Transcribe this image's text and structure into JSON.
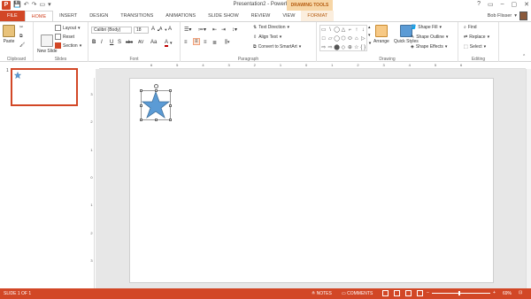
{
  "window": {
    "title": "Presentation2 - PowerPoint",
    "contextual_banner": "DRAWING TOOLS",
    "user": "Bob Flisser",
    "controls": [
      "?",
      "▭",
      "–",
      "▢",
      "✕"
    ]
  },
  "tabs": [
    "FILE",
    "HOME",
    "INSERT",
    "DESIGN",
    "TRANSITIONS",
    "ANIMATIONS",
    "SLIDE SHOW",
    "REVIEW",
    "VIEW",
    "FORMAT"
  ],
  "ribbon": {
    "clipboard": {
      "label": "Clipboard",
      "paste": "Paste"
    },
    "slides": {
      "label": "Slides",
      "new_slide": "New Slide",
      "layout": "Layout",
      "reset": "Reset",
      "section": "Section"
    },
    "font": {
      "label": "Font",
      "font_name": "Calibri (Body)",
      "font_size": "18",
      "bold": "B",
      "italic": "I",
      "underline": "U",
      "strike": "S",
      "shadow": "abc",
      "spacing": "AV",
      "case": "Aa",
      "grow": "A",
      "shrink": "A",
      "clear": "A"
    },
    "paragraph": {
      "label": "Paragraph",
      "text_direction": "Text Direction",
      "align_text": "Align Text",
      "convert_smartart": "Convert to SmartArt"
    },
    "drawing": {
      "label": "Drawing",
      "arrange": "Arrange",
      "quick_styles": "Quick Styles",
      "shape_fill": "Shape Fill",
      "shape_outline": "Shape Outline",
      "shape_effects": "Shape Effects"
    },
    "editing": {
      "label": "Editing",
      "find": "Find",
      "replace": "Replace",
      "select": "Select"
    }
  },
  "shapes_gallery": [
    "▭",
    "\\",
    "◯",
    "△",
    "⌐",
    "↑",
    "↓",
    "□",
    "▱",
    "◯",
    "⬡",
    "⬭",
    "⌂",
    "▷",
    "⇨",
    "⇨",
    "⬤",
    "◇",
    "⊕",
    "☆",
    "{ }",
    "}"
  ],
  "thumbnail": {
    "number": "1"
  },
  "rulers": {
    "horizontal": [
      "6",
      "5",
      "4",
      "3",
      "2",
      "1",
      "0",
      "1",
      "2",
      "3",
      "4",
      "5",
      "6"
    ],
    "vertical": [
      "3",
      "2",
      "1",
      "0",
      "1",
      "2",
      "3"
    ]
  },
  "status": {
    "slide_count": "SLIDE 1 OF 1",
    "notes": "NOTES",
    "comments": "COMMENTS",
    "zoom": "69%"
  },
  "colors": {
    "accent": "#d24726",
    "star": "#5b9bd5",
    "star_outline": "#41719c"
  }
}
